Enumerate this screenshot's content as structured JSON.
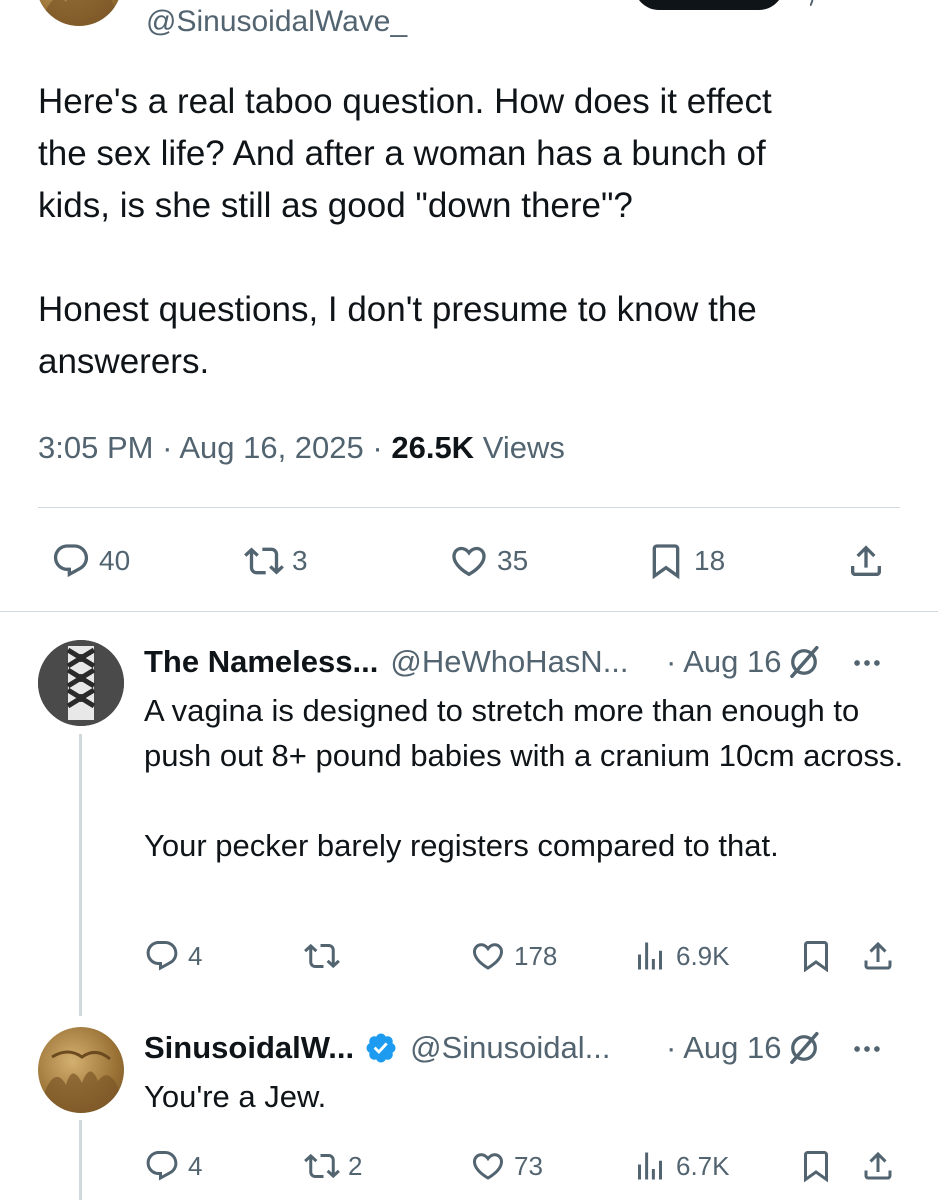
{
  "main_tweet": {
    "handle": "@SinusoidalWave_",
    "text_paragraphs": [
      "Here's a real taboo question. How does it effect\nthe sex life? And after a woman has a bunch of\nkids, is she still as good \"down there\"?",
      "Honest questions, I don't presume to know the\nanswerers."
    ],
    "time": "3:05 PM",
    "date": "Aug 16, 2025",
    "views_count": "26.5K",
    "views_label": "Views",
    "separator": "·",
    "actions": {
      "replies": "40",
      "reposts": "3",
      "likes": "35",
      "bookmarks": "18"
    }
  },
  "replies": [
    {
      "name": "The Nameless...",
      "handle": "@HeWhoHasN...",
      "date": "· Aug 16",
      "verified": false,
      "text_paragraphs": [
        "A vagina is designed to stretch more than enough to push out 8+ pound babies with a cranium 10cm across.",
        "Your pecker barely registers compared to that."
      ],
      "actions": {
        "replies": "4",
        "reposts": "",
        "likes": "178",
        "views": "6.9K"
      }
    },
    {
      "name": "SinusoidalW...",
      "handle": "@Sinusoidal...",
      "date": "· Aug 16",
      "verified": true,
      "text_paragraphs": [
        "You're a Jew."
      ],
      "actions": {
        "replies": "4",
        "reposts": "2",
        "likes": "73",
        "views": "6.7K"
      }
    }
  ],
  "icons": {
    "reply": "speech-bubble-icon",
    "repost": "repost-arrows-icon",
    "like": "heart-icon",
    "bookmark": "bookmark-icon",
    "share": "share-upload-icon",
    "views": "bar-chart-icon",
    "grok": "grok-slash-icon",
    "more": "more-dots-icon",
    "verified": "verified-badge-icon"
  },
  "colors": {
    "text": "#0f1419",
    "secondary": "#536471",
    "divider": "#cfd9de",
    "verified": "#1d9bf0"
  }
}
